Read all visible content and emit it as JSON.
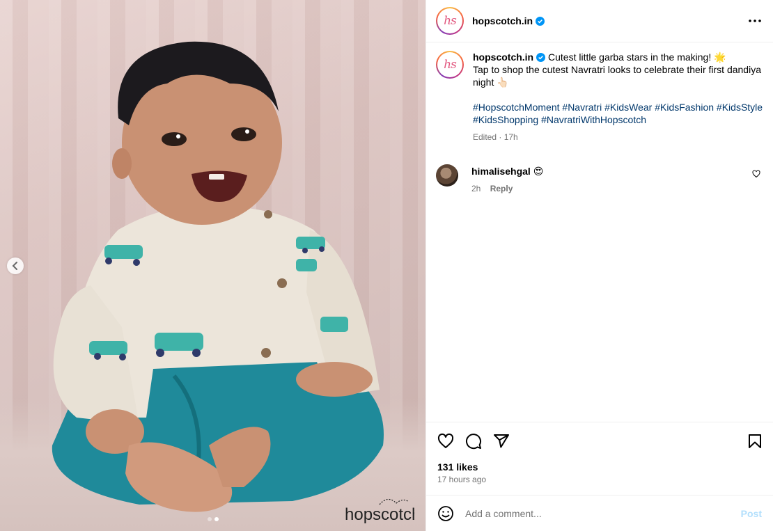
{
  "post": {
    "account": {
      "username": "hopscotch.in",
      "avatar_text": "hs",
      "verified_icon": "verified-badge-icon"
    },
    "media": {
      "watermark": "hopscotch",
      "slides": 2,
      "active_slide": 2
    },
    "caption": {
      "username": "hopscotch.in",
      "line1": "Cutest little garba stars in the making! 🌟",
      "line2": "Tap to shop the cutest Navratri looks to celebrate their first dandiya night 👆🏻",
      "hashtags": [
        "#HopscotchMoment",
        "#Navratri",
        "#KidsWear",
        "#KidsFashion",
        "#KidsStyle",
        "#KidsShopping",
        "#NavratriWithHopscotch"
      ],
      "meta": "Edited · 17h"
    },
    "comments": [
      {
        "username": "himalisehgal",
        "text": "😍",
        "age": "2h",
        "reply_label": "Reply"
      }
    ],
    "stats": {
      "likes": "131 likes",
      "posted": "17 hours ago"
    },
    "composer": {
      "placeholder": "Add a comment...",
      "post_label": "Post"
    },
    "colors": {
      "link": "#00376b",
      "muted": "#737373",
      "post_disabled": "#b2dffc",
      "verified": "#0095f6"
    }
  }
}
